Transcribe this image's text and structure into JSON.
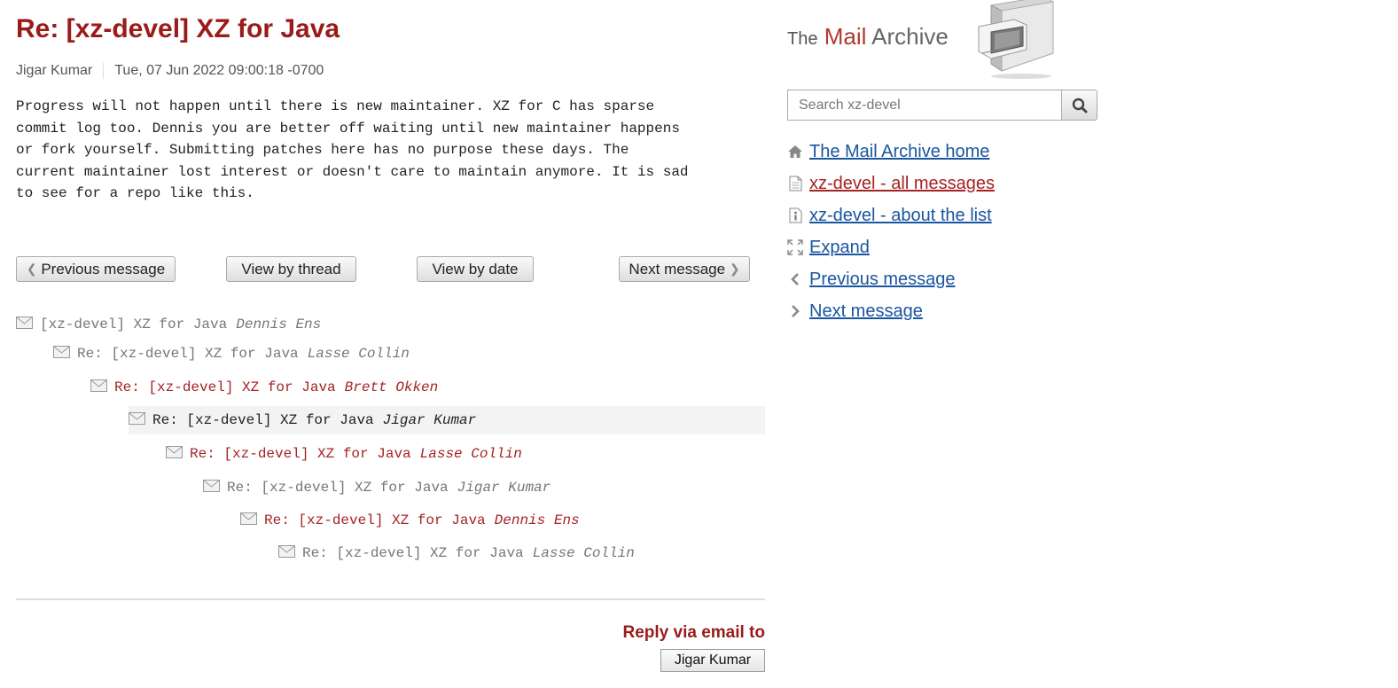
{
  "message": {
    "title": "Re: [xz-devel] XZ for Java",
    "author": "Jigar Kumar",
    "date": "Tue, 07 Jun 2022 09:00:18 -0700",
    "body": "Progress will not happen until there is new maintainer. XZ for C has sparse\ncommit log too. Dennis you are better off waiting until new maintainer happens\nor fork yourself. Submitting patches here has no purpose these days. The\ncurrent maintainer lost interest or doesn't care to maintain anymore. It is sad\nto see for a repo like this."
  },
  "buttons": {
    "previous": "Previous message",
    "thread": "View by thread",
    "date": "View by date",
    "next": "Next message"
  },
  "thread": [
    {
      "subject": "[xz-devel] XZ for Java",
      "author": "Dennis Ens"
    },
    {
      "subject": "Re: [xz-devel] XZ for Java",
      "author": "Lasse Collin"
    },
    {
      "subject": "Re: [xz-devel] XZ for Java",
      "author": "Brett Okken"
    },
    {
      "subject": "Re: [xz-devel] XZ for Java",
      "author": "Jigar Kumar"
    },
    {
      "subject": "Re: [xz-devel] XZ for Java",
      "author": "Lasse Collin"
    },
    {
      "subject": "Re: [xz-devel] XZ for Java",
      "author": "Jigar Kumar"
    },
    {
      "subject": "Re: [xz-devel] XZ for Java",
      "author": "Dennis Ens"
    },
    {
      "subject": "Re: [xz-devel] XZ for Java",
      "author": "Lasse Collin"
    }
  ],
  "reply": {
    "heading": "Reply via email to",
    "recipient": "Jigar Kumar"
  },
  "sidebar": {
    "logo_the": "The",
    "logo_mail": "Mail",
    "logo_archive": "Archive",
    "search_placeholder": "Search xz-devel",
    "nav": [
      {
        "label": "The Mail Archive home",
        "icon": "home-icon"
      },
      {
        "label": "xz-devel - all messages",
        "icon": "document-icon"
      },
      {
        "label": "xz-devel - about the list",
        "icon": "info-icon"
      },
      {
        "label": "Expand",
        "icon": "expand-icon"
      },
      {
        "label": "Previous message",
        "icon": "chevron-left-icon"
      },
      {
        "label": "Next message",
        "icon": "chevron-right-icon"
      }
    ]
  },
  "colors": {
    "accent_red": "#9b1b1b",
    "link_blue": "#1a56a0"
  }
}
